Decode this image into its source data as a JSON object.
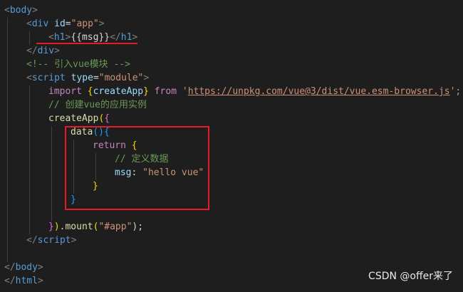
{
  "code": {
    "l1": {
      "t1": "<",
      "t2": "body",
      "t3": ">"
    },
    "l2": {
      "t1": "<",
      "t2": "div",
      "t3": " ",
      "t4": "id",
      "t5": "=",
      "t6": "\"app\"",
      "t7": ">"
    },
    "l3": {
      "t1": "<",
      "t2": "h1",
      "t3": ">",
      "t4": "{{msg}}",
      "t5": "</",
      "t6": "h1",
      "t7": ">"
    },
    "l4": {
      "t1": "</",
      "t2": "div",
      "t3": ">"
    },
    "l5": {
      "t1": "<!-- 引入vue模块 -->"
    },
    "l6": {
      "t1": "<",
      "t2": "script",
      "t3": " ",
      "t4": "type",
      "t5": "=",
      "t6": "\"module\"",
      "t7": ">"
    },
    "l7": {
      "t1": "import",
      "t2": " ",
      "t3": "{",
      "t4": "createApp",
      "t5": "}",
      "t6": " ",
      "t7": "from",
      "t8": " '",
      "t9": "https://unpkg.com/vue@3/dist/vue.esm-browser.js",
      "t10": "';"
    },
    "l8": {
      "t1": "// 创建vue的应用实例"
    },
    "l9": {
      "t1": "createApp",
      "t2": "(",
      "t3": "{"
    },
    "l10": {
      "t1": "data",
      "t2": "()",
      "t3": "{"
    },
    "l11": {
      "t1": "return",
      "t2": " ",
      "t3": "{"
    },
    "l12": {
      "t1": "// 定义数据"
    },
    "l13": {
      "t1": "msg",
      "t2": ": ",
      "t3": "\"hello vue\""
    },
    "l14": {
      "t1": "}"
    },
    "l15": {
      "t1": "}"
    },
    "l17": {
      "t1": "}",
      "t2": ")",
      "t3": ".",
      "t4": "mount",
      "t5": "(",
      "t6": "\"#app\"",
      "t7": ");"
    },
    "l18": {
      "t1": "</",
      "t2": "script",
      "t3": ">"
    },
    "l20": {
      "t1": "</",
      "t2": "body",
      "t3": ">"
    },
    "l21": {
      "t1": "</",
      "t2": "html",
      "t3": ">"
    }
  },
  "watermark": "CSDN @offer来了",
  "colors": {
    "background": "#1e1e1e",
    "annotation_red": "#e51c23",
    "tag": "#569cd6",
    "string": "#ce9178",
    "comment": "#6a9955",
    "keyword": "#c586c0",
    "function": "#dcdcaa"
  }
}
